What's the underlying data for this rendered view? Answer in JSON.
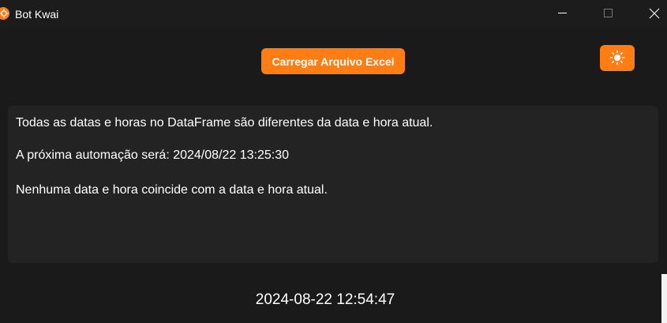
{
  "window": {
    "title": "Bot Kwai",
    "icon": "kwai-logo-icon",
    "controls": [
      "minimize-icon",
      "maximize-icon",
      "close-icon"
    ]
  },
  "toolbar": {
    "load_excel_label": "Carregar Arquivo Excel",
    "theme_toggle_icon": "sun-icon"
  },
  "messages": [
    "Todas as datas e horas no DataFrame são diferentes da data e hora atual.",
    "A próxima automação será: 2024/08/22 13:25:30",
    "Nenhuma data e hora coincide com a data e hora atual."
  ],
  "clock": {
    "current_datetime": "2024-08-22 12:54:47"
  },
  "colors": {
    "accent": "#ff7d12",
    "background": "#1a1a1a",
    "panel": "#232323",
    "text": "#ffffff"
  }
}
